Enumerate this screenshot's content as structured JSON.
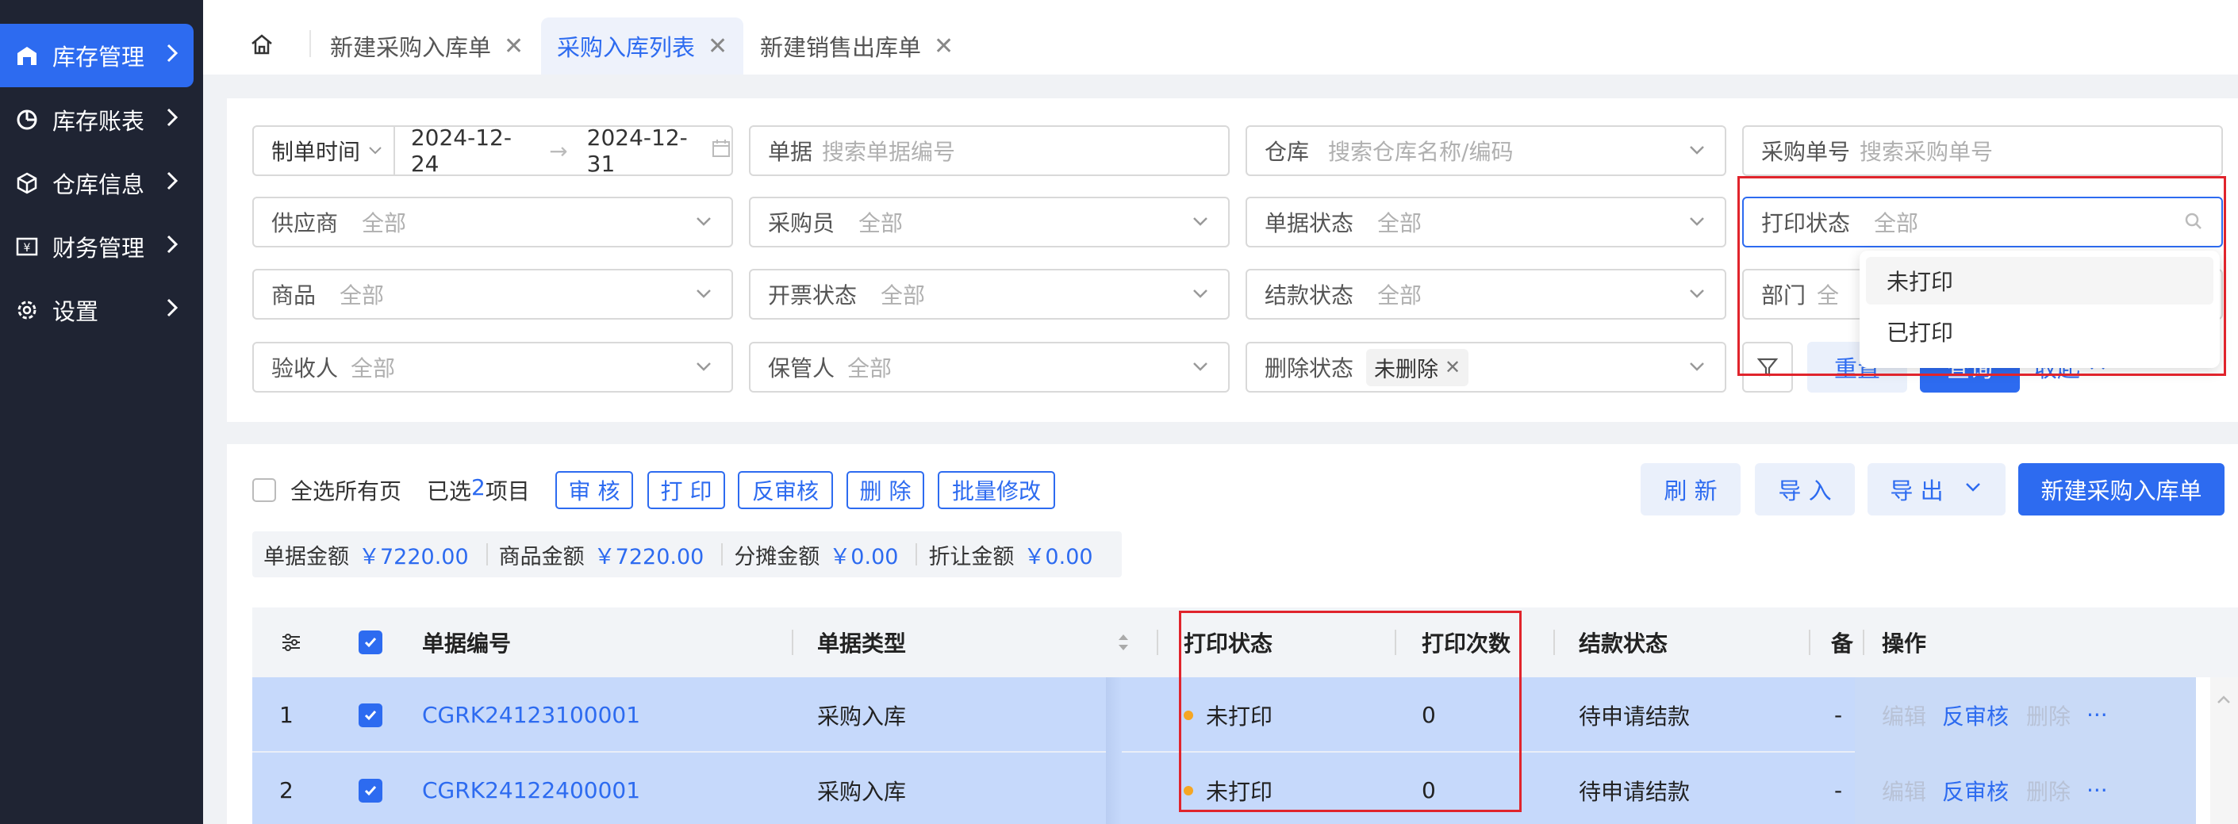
{
  "sidebar": {
    "items": [
      {
        "label": "库存管理",
        "icon": "warehouse-icon",
        "active": true
      },
      {
        "label": "库存账表",
        "icon": "pie-chart-icon",
        "active": false
      },
      {
        "label": "仓库信息",
        "icon": "cube-icon",
        "active": false
      },
      {
        "label": "财务管理",
        "icon": "yen-icon",
        "active": false
      },
      {
        "label": "设置",
        "icon": "gear-icon",
        "active": false
      }
    ]
  },
  "tabs": [
    {
      "label": "新建采购入库单",
      "active": false
    },
    {
      "label": "采购入库列表",
      "active": true
    },
    {
      "label": "新建销售出库单",
      "active": false
    }
  ],
  "filters": {
    "date": {
      "label": "制单时间",
      "start": "2024-12-24",
      "arrow": "→",
      "end": "2024-12-31"
    },
    "doc": {
      "label": "单据",
      "placeholder": "搜索单据编号"
    },
    "warehouse": {
      "label": "仓库",
      "placeholder": "搜索仓库名称/编码"
    },
    "purchase_no": {
      "label": "采购单号",
      "placeholder": "搜索采购单号"
    },
    "supplier": {
      "label": "供应商",
      "value": "全部"
    },
    "buyer": {
      "label": "采购员",
      "value": "全部"
    },
    "doc_status": {
      "label": "单据状态",
      "value": "全部"
    },
    "print_status": {
      "label": "打印状态",
      "value": "全部"
    },
    "product": {
      "label": "商品",
      "value": "全部"
    },
    "invoice_status": {
      "label": "开票状态",
      "value": "全部"
    },
    "settle_status": {
      "label": "结款状态",
      "value": "全部"
    },
    "department": {
      "label": "部门",
      "value": "全"
    },
    "inspector": {
      "label": "验收人",
      "value": "全部"
    },
    "keeper": {
      "label": "保管人",
      "value": "全部"
    },
    "delete_status": {
      "label": "删除状态",
      "tag": "未删除"
    },
    "reset_label": "重置",
    "query_label": "查询",
    "collapse_label": "收起"
  },
  "print_dropdown": {
    "options": [
      "未打印",
      "已打印"
    ]
  },
  "toolbar": {
    "select_all": "全选所有页",
    "selected_prefix": "已选",
    "selected_count": "2",
    "selected_suffix": "项目",
    "audit": "审 核",
    "print": "打 印",
    "unaudit": "反审核",
    "delete": "删 除",
    "batch_edit": "批量修改",
    "refresh": "刷 新",
    "import": "导 入",
    "export": "导 出",
    "new_inbound": "新建采购入库单"
  },
  "summary": [
    {
      "label": "单据金额",
      "value": "￥7220.00"
    },
    {
      "label": "商品金额",
      "value": "￥7220.00"
    },
    {
      "label": "分摊金额",
      "value": "￥0.00"
    },
    {
      "label": "折让金额",
      "value": "￥0.00"
    }
  ],
  "table": {
    "headers": {
      "doc_no": "单据编号",
      "doc_type": "单据类型",
      "print_status": "打印状态",
      "print_count": "打印次数",
      "settle_status": "结款状态",
      "remark": "备",
      "ops": "操作"
    },
    "rows": [
      {
        "index": "1",
        "doc_no": "CGRK24123100001",
        "doc_type": "采购入库",
        "print_status": "未打印",
        "print_count": "0",
        "settle_status": "待申请结款",
        "remark": "-",
        "op_edit": "编辑",
        "op_unaudit": "反审核",
        "op_delete": "删除",
        "op_more": "···"
      },
      {
        "index": "2",
        "doc_no": "CGRK24122400001",
        "doc_type": "采购入库",
        "print_status": "未打印",
        "print_count": "0",
        "settle_status": "待申请结款",
        "remark": "-",
        "op_edit": "编辑",
        "op_unaudit": "反审核",
        "op_delete": "删除",
        "op_more": "···"
      }
    ]
  },
  "colors": {
    "accent": "#2d6bf0",
    "sidebar_bg": "#1f2433",
    "highlight_box": "#e0242c",
    "row_selected": "#c6d9fb",
    "status_dot": "#f5a623"
  }
}
